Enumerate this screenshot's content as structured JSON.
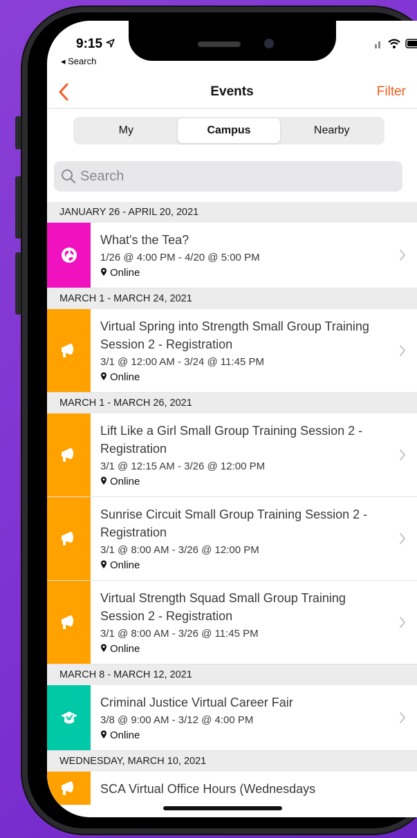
{
  "status": {
    "time": "9:15",
    "back_label": "◂ Search"
  },
  "nav": {
    "title": "Events",
    "filter_label": "Filter"
  },
  "segments": [
    "My",
    "Campus",
    "Nearby"
  ],
  "segment_active": 1,
  "search": {
    "placeholder": "Search"
  },
  "colors": {
    "accent": "#f25b1d",
    "pink": "#f012be",
    "orange": "#ffa200",
    "teal": "#00c9a7"
  },
  "sections": [
    {
      "header": "JANUARY 26 - APRIL 20, 2021",
      "events": [
        {
          "title": "What's the Tea?",
          "time": "1/26 @ 4:00 PM - 4/20 @ 5:00 PM",
          "location": "Online",
          "color": "#f012be",
          "icon": "globe-icon"
        }
      ]
    },
    {
      "header": "MARCH 1 - MARCH 24, 2021",
      "events": [
        {
          "title": "Virtual Spring into Strength Small Group Training Session 2 - Registration",
          "time": "3/1 @ 12:00 AM - 3/24 @ 11:45 PM",
          "location": "Online",
          "color": "#ffa200",
          "icon": "megaphone-icon"
        }
      ]
    },
    {
      "header": "MARCH 1 - MARCH 26, 2021",
      "events": [
        {
          "title": "Lift Like a Girl Small Group Training Session 2 - Registration",
          "time": "3/1 @ 12:15 AM - 3/26 @ 12:00 PM",
          "location": "Online",
          "color": "#ffa200",
          "icon": "megaphone-icon"
        },
        {
          "title": "Sunrise Circuit Small Group Training Session 2 - Registration",
          "time": "3/1 @ 8:00 AM - 3/26 @ 12:00 PM",
          "location": "Online",
          "color": "#ffa200",
          "icon": "megaphone-icon"
        },
        {
          "title": "Virtual Strength Squad Small Group Training Session 2 - Registration",
          "time": "3/1 @ 8:00 AM - 3/26 @ 11:45 PM",
          "location": "Online",
          "color": "#ffa200",
          "icon": "megaphone-icon"
        }
      ]
    },
    {
      "header": "MARCH 8 - MARCH 12, 2021",
      "events": [
        {
          "title": "Criminal Justice Virtual Career Fair",
          "time": "3/8 @ 9:00 AM - 3/12 @ 4:00 PM",
          "location": "Online",
          "color": "#00c9a7",
          "icon": "graduation-cap-icon"
        }
      ]
    },
    {
      "header": "WEDNESDAY, MARCH 10, 2021",
      "events": [
        {
          "title": "SCA Virtual Office Hours (Wednesdays",
          "time": "",
          "location": "",
          "color": "#ffa200",
          "icon": "megaphone-icon"
        }
      ]
    }
  ]
}
